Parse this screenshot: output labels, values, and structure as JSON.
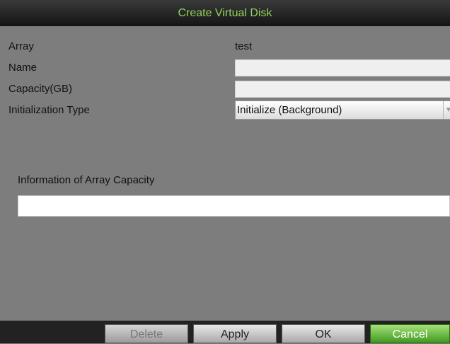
{
  "dialog": {
    "title": "Create Virtual Disk"
  },
  "form": {
    "array_label": "Array",
    "array_value": "test",
    "name_label": "Name",
    "name_value": "",
    "capacity_label": "Capacity(GB)",
    "capacity_value": "",
    "init_type_label": "Initialization Type",
    "init_type_value": "Initialize (Background)"
  },
  "info": {
    "label": "Information of Array Capacity",
    "value": ""
  },
  "buttons": {
    "delete": "Delete",
    "apply": "Apply",
    "ok": "OK",
    "cancel": "Cancel"
  },
  "colors": {
    "title_text": "#8fd45a",
    "cancel_bg": "#3f9a1f"
  }
}
